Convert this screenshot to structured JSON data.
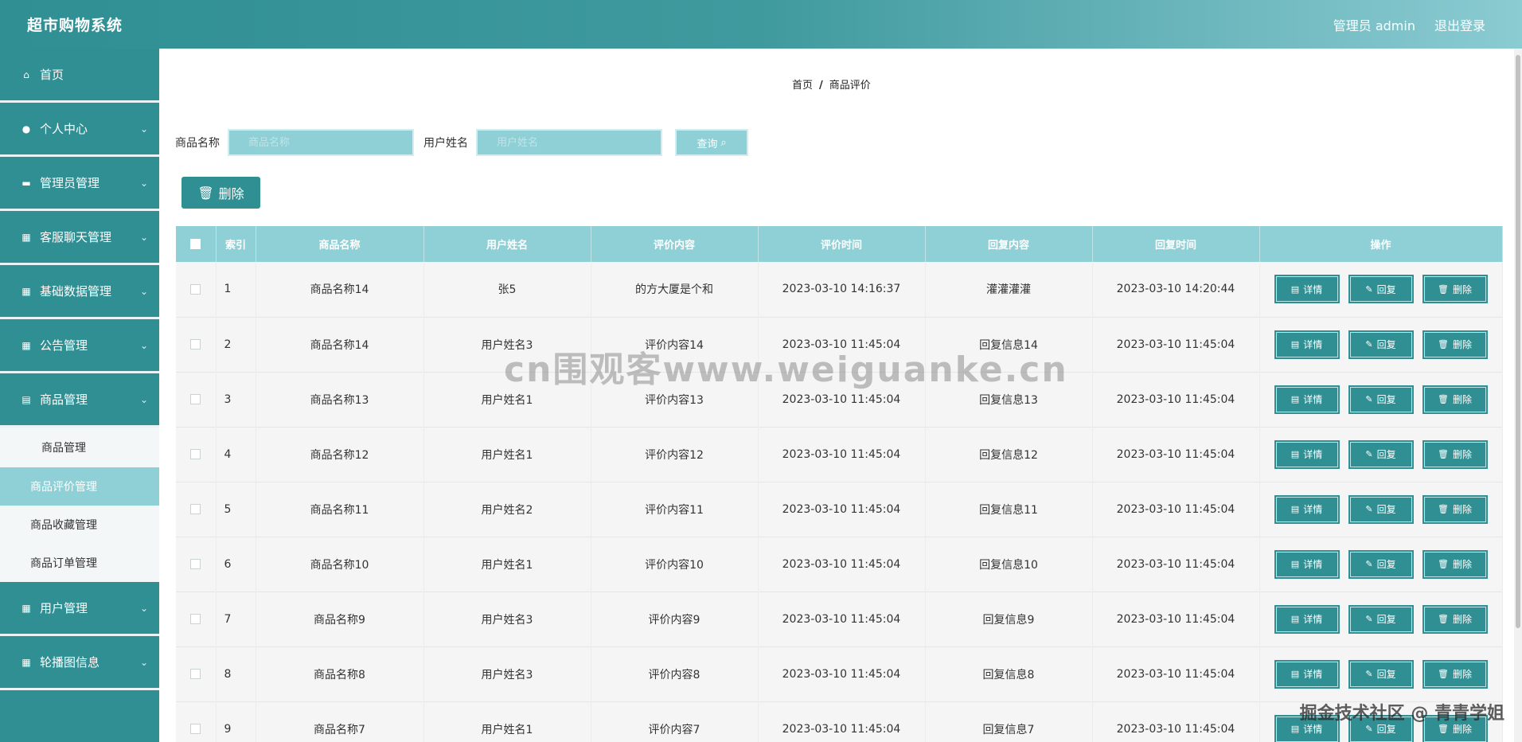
{
  "header": {
    "title": "超市购物系统",
    "admin_label": "管理员 admin",
    "logout_label": "退出登录"
  },
  "sidebar": {
    "items": [
      {
        "label": "首页",
        "icon": "home-icon",
        "has_chevron": false
      },
      {
        "label": "个人中心",
        "icon": "user-icon",
        "has_chevron": true
      },
      {
        "label": "管理员管理",
        "icon": "monitor-icon",
        "has_chevron": true
      },
      {
        "label": "客服聊天管理",
        "icon": "grid-icon",
        "has_chevron": true
      },
      {
        "label": "基础数据管理",
        "icon": "grid-icon",
        "has_chevron": true
      },
      {
        "label": "公告管理",
        "icon": "grid-icon",
        "has_chevron": true
      },
      {
        "label": "商品管理",
        "icon": "document-icon",
        "has_chevron": true
      }
    ],
    "subitems": [
      {
        "label": "商品管理"
      },
      {
        "label": "商品评价管理",
        "active": true
      },
      {
        "label": "商品收藏管理"
      },
      {
        "label": "商品订单管理"
      }
    ],
    "items_after": [
      {
        "label": "用户管理",
        "icon": "grid-icon"
      },
      {
        "label": "轮播图信息",
        "icon": "grid-icon"
      }
    ]
  },
  "breadcrumb": {
    "home": "首页",
    "sep": "/",
    "current": "商品评价"
  },
  "search": {
    "product_label": "商品名称",
    "product_placeholder": "商品名称",
    "user_label": "用户姓名",
    "user_placeholder": "用户姓名",
    "query_label": "查询"
  },
  "toolbar": {
    "delete_label": "删除"
  },
  "table": {
    "columns": [
      "索引",
      "商品名称",
      "用户姓名",
      "评价内容",
      "评价时间",
      "回复内容",
      "回复时间",
      "操作"
    ],
    "actions": {
      "detail": "详情",
      "reply": "回复",
      "delete": "删除"
    },
    "rows": [
      {
        "idx": "1",
        "product": "商品名称14",
        "user": "张5",
        "content": "的方大厦是个和",
        "time": "2023-03-10 14:16:37",
        "reply": "灌灌灌灌",
        "reply_time": "2023-03-10 14:20:44"
      },
      {
        "idx": "2",
        "product": "商品名称14",
        "user": "用户姓名3",
        "content": "评价内容14",
        "time": "2023-03-10 11:45:04",
        "reply": "回复信息14",
        "reply_time": "2023-03-10 11:45:04"
      },
      {
        "idx": "3",
        "product": "商品名称13",
        "user": "用户姓名1",
        "content": "评价内容13",
        "time": "2023-03-10 11:45:04",
        "reply": "回复信息13",
        "reply_time": "2023-03-10 11:45:04"
      },
      {
        "idx": "4",
        "product": "商品名称12",
        "user": "用户姓名1",
        "content": "评价内容12",
        "time": "2023-03-10 11:45:04",
        "reply": "回复信息12",
        "reply_time": "2023-03-10 11:45:04"
      },
      {
        "idx": "5",
        "product": "商品名称11",
        "user": "用户姓名2",
        "content": "评价内容11",
        "time": "2023-03-10 11:45:04",
        "reply": "回复信息11",
        "reply_time": "2023-03-10 11:45:04"
      },
      {
        "idx": "6",
        "product": "商品名称10",
        "user": "用户姓名1",
        "content": "评价内容10",
        "time": "2023-03-10 11:45:04",
        "reply": "回复信息10",
        "reply_time": "2023-03-10 11:45:04"
      },
      {
        "idx": "7",
        "product": "商品名称9",
        "user": "用户姓名3",
        "content": "评价内容9",
        "time": "2023-03-10 11:45:04",
        "reply": "回复信息9",
        "reply_time": "2023-03-10 11:45:04"
      },
      {
        "idx": "8",
        "product": "商品名称8",
        "user": "用户姓名3",
        "content": "评价内容8",
        "time": "2023-03-10 11:45:04",
        "reply": "回复信息8",
        "reply_time": "2023-03-10 11:45:04"
      },
      {
        "idx": "9",
        "product": "商品名称7",
        "user": "用户姓名1",
        "content": "评价内容7",
        "time": "2023-03-10 11:45:04",
        "reply": "回复信息7",
        "reply_time": "2023-03-10 11:45:04"
      }
    ]
  },
  "watermarks": {
    "center": "cn围观客www.weiguanke.cn",
    "corner": "掘金技术社区 @ 青青学姐"
  },
  "colors": {
    "primary": "#2f8f93",
    "light": "#8fd0d6",
    "row_bg": "#f5f5f5"
  }
}
